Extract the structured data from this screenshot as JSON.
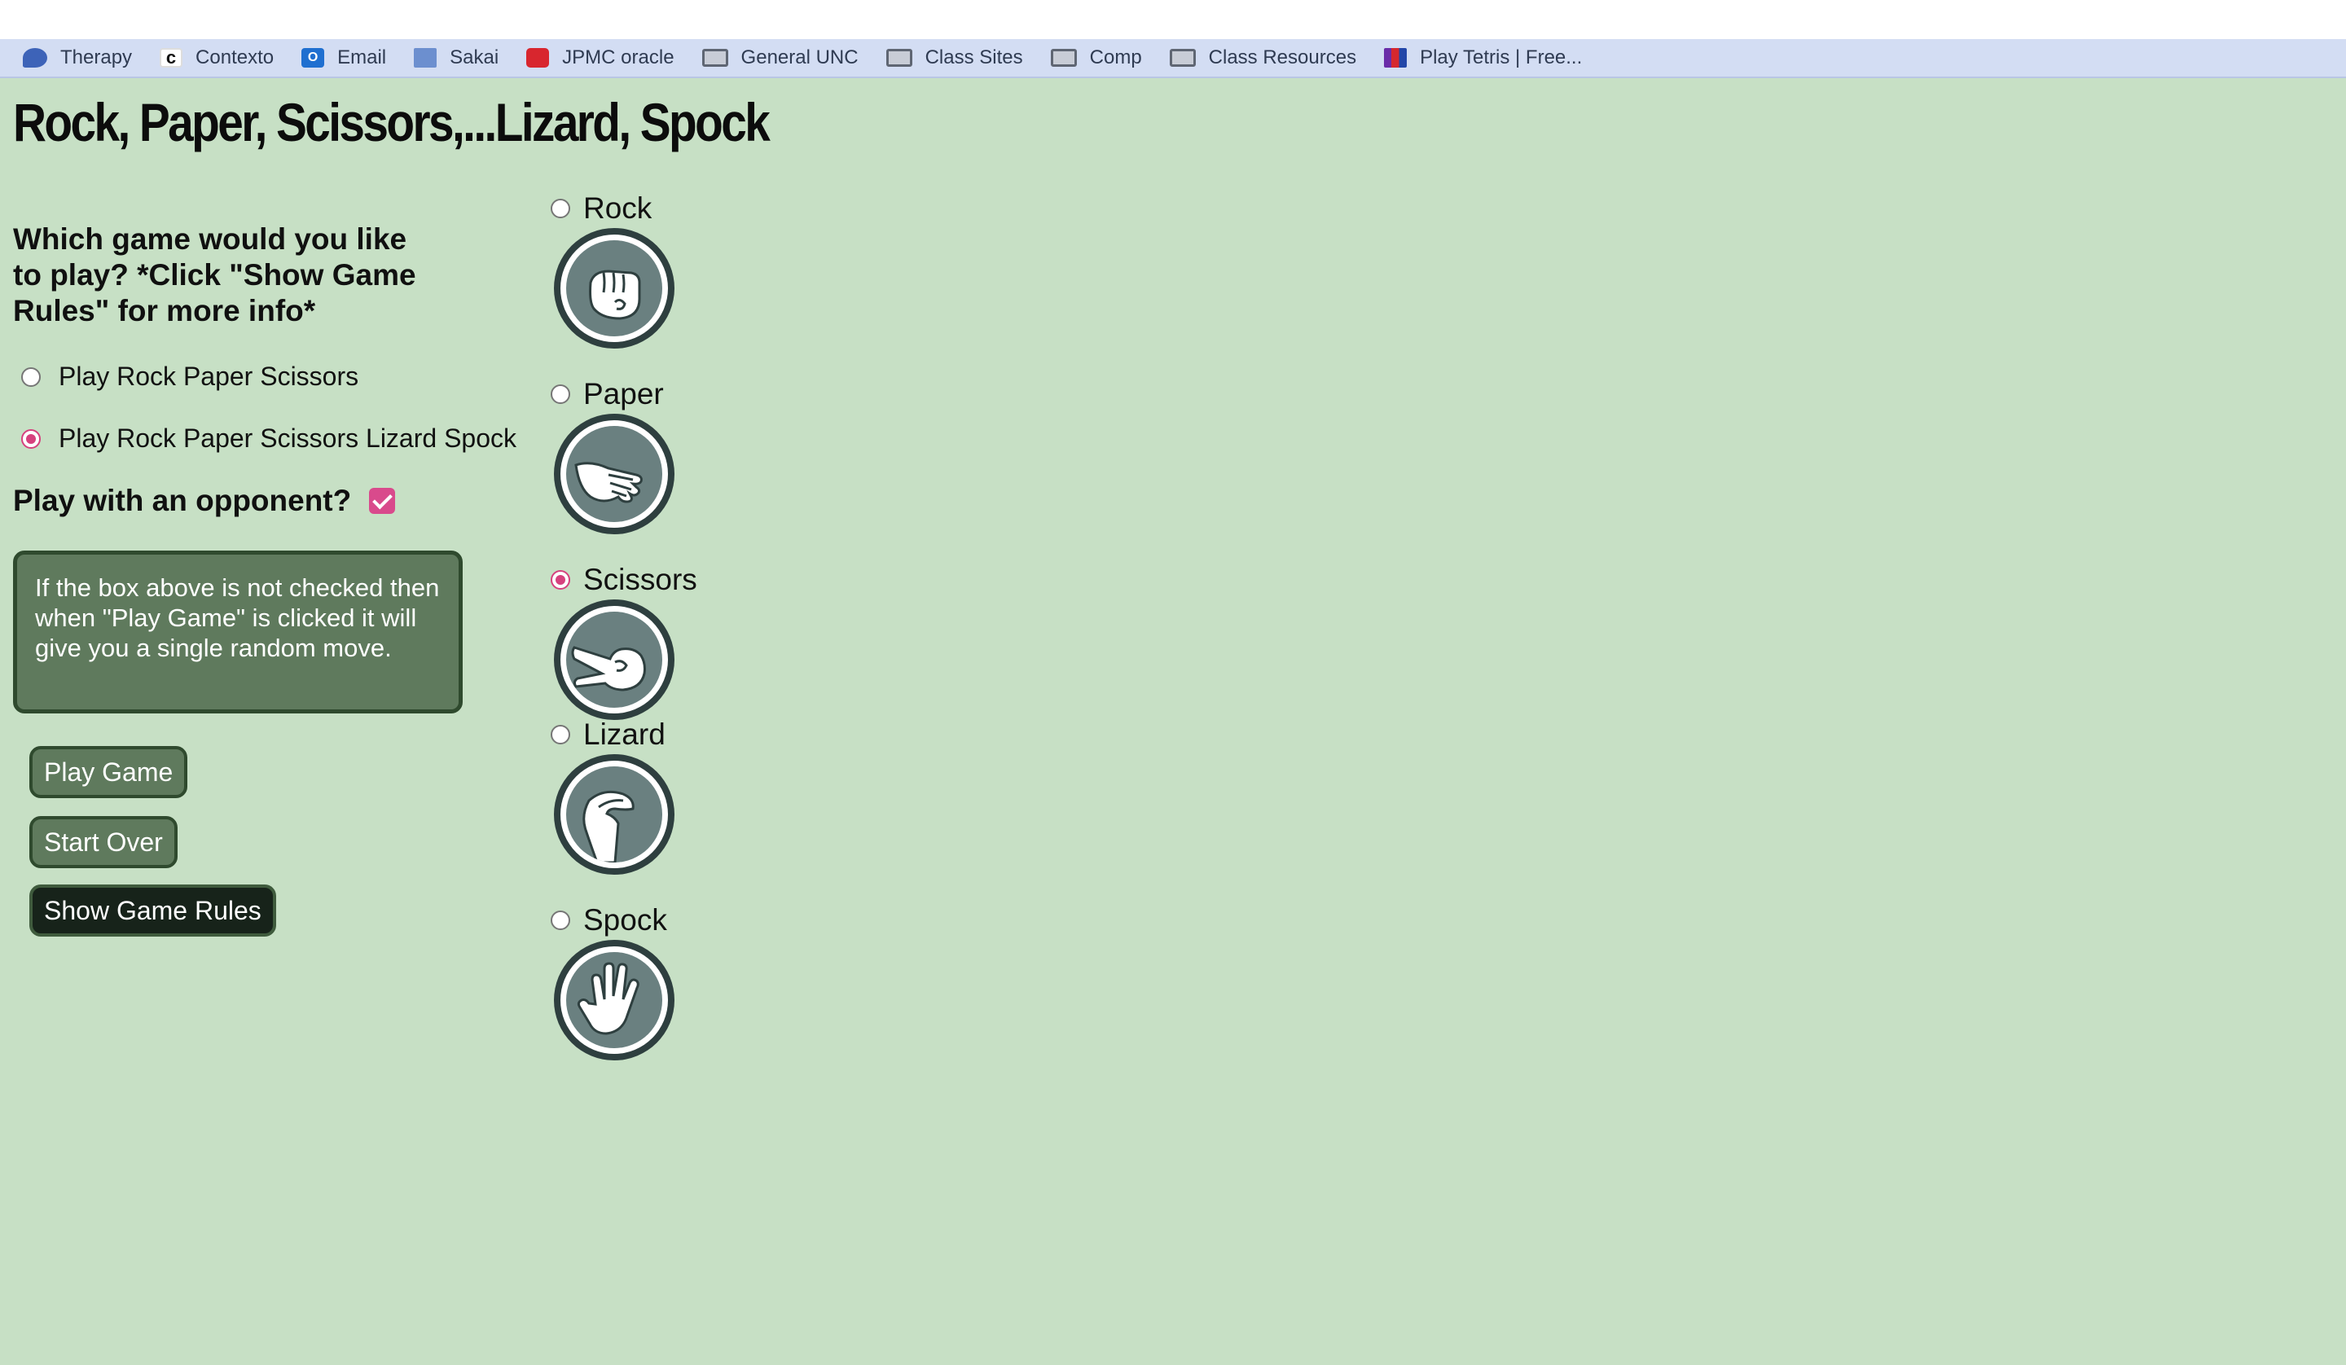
{
  "bookmarks": [
    {
      "label": "Therapy",
      "icon": "therapy-icon"
    },
    {
      "label": "Contexto",
      "icon": "contexto-icon"
    },
    {
      "label": "Email",
      "icon": "email-icon"
    },
    {
      "label": "Sakai",
      "icon": "sakai-icon"
    },
    {
      "label": "JPMC oracle",
      "icon": "jpmc-icon"
    },
    {
      "label": "General UNC",
      "icon": "folder-icon"
    },
    {
      "label": "Class Sites",
      "icon": "folder-icon"
    },
    {
      "label": "Comp",
      "icon": "folder-icon"
    },
    {
      "label": "Class Resources",
      "icon": "folder-icon"
    },
    {
      "label": "Play Tetris | Free...",
      "icon": "tetris-icon"
    }
  ],
  "page": {
    "title": "Rock, Paper, Scissors,...Lizard, Spock",
    "question": "Which game would you like to play? *Click \"Show Game Rules\" for more info*",
    "game_options": [
      {
        "label": "Play Rock Paper Scissors",
        "selected": false
      },
      {
        "label": "Play Rock Paper Scissors Lizard Spock",
        "selected": true
      }
    ],
    "opponent_label": "Play with an opponent?",
    "opponent_checked": true,
    "note": "If the box above is not checked then when \"Play Game\" is clicked it will give you a single random move.",
    "buttons": {
      "play": "Play Game",
      "start_over": "Start Over",
      "rules": "Show Game Rules"
    },
    "moves": [
      {
        "label": "Rock",
        "selected": false,
        "icon": "rock-hand-icon"
      },
      {
        "label": "Paper",
        "selected": false,
        "icon": "paper-hand-icon"
      },
      {
        "label": "Scissors",
        "selected": true,
        "icon": "scissors-hand-icon"
      },
      {
        "label": "Lizard",
        "selected": false,
        "icon": "lizard-hand-icon"
      },
      {
        "label": "Spock",
        "selected": false,
        "icon": "spock-hand-icon"
      }
    ]
  },
  "colors": {
    "background": "#c7e0c5",
    "accent": "#d6417e",
    "button": "#5f7a5d",
    "button_dark": "#17231a"
  }
}
